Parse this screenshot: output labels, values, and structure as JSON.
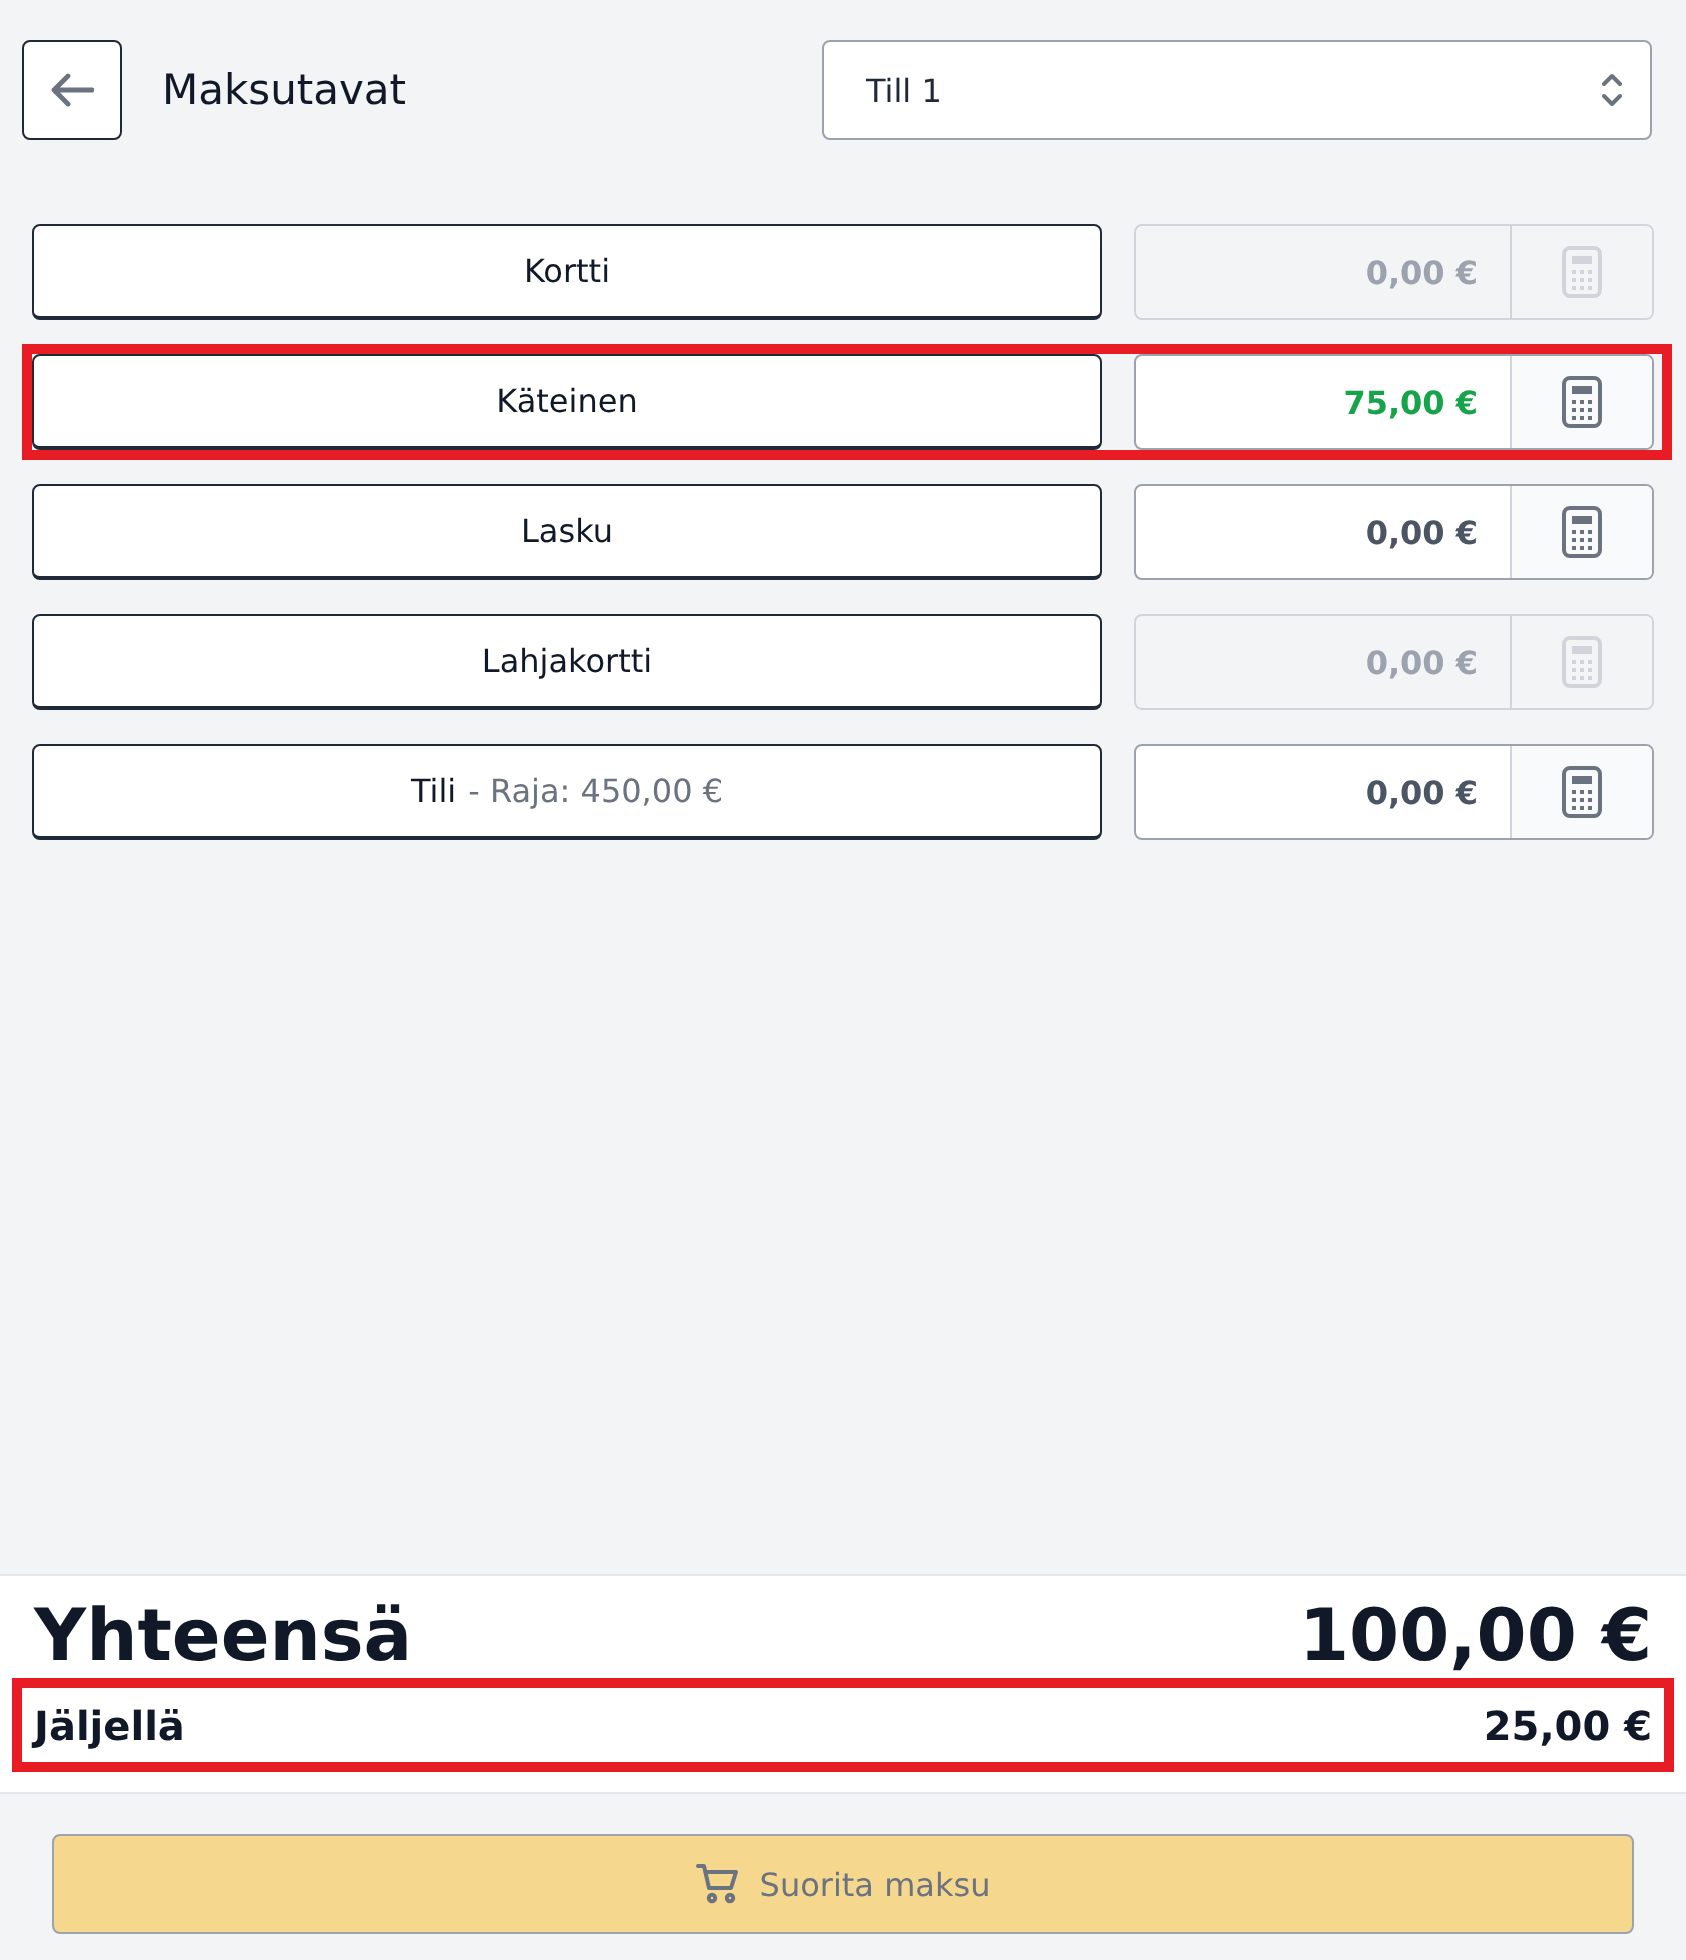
{
  "header": {
    "title": "Maksutavat",
    "till_select": {
      "value": "Till 1"
    }
  },
  "payment_methods": [
    {
      "label": "Kortti",
      "amount": "0,00 €",
      "disabled": true,
      "paid": false,
      "highlighted": false
    },
    {
      "label": "Käteinen",
      "amount": "75,00 €",
      "disabled": false,
      "paid": true,
      "highlighted": true
    },
    {
      "label": "Lasku",
      "amount": "0,00 €",
      "disabled": false,
      "paid": false,
      "highlighted": false
    },
    {
      "label": "Lahjakortti",
      "amount": "0,00 €",
      "disabled": true,
      "paid": false,
      "highlighted": false
    },
    {
      "label": "Tili",
      "note": "- Raja: 450,00 €",
      "amount": "0,00 €",
      "disabled": false,
      "paid": false,
      "highlighted": false
    }
  ],
  "summary": {
    "total_label": "Yhteensä",
    "total": "100,00 €",
    "remaining_label": "Jäljellä",
    "remaining": "25,00 €",
    "remaining_highlighted": true
  },
  "pay_button": {
    "label": "Suorita maksu",
    "disabled": true
  }
}
